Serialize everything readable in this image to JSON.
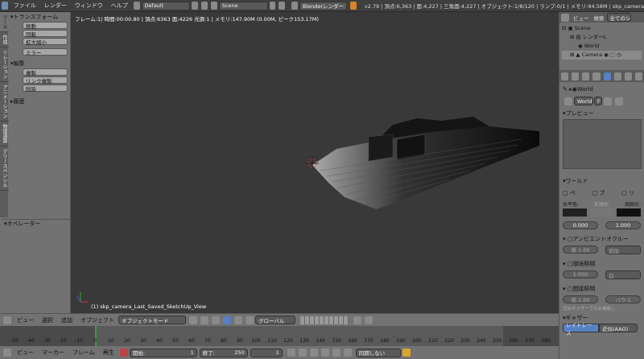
{
  "menu": {
    "file": "ファイル",
    "render": "レンダー",
    "window": "ウィンドウ",
    "help": "ヘルプ"
  },
  "screen_layout": "Default",
  "scene_name": "Scene",
  "engine": "Blenderレンダー",
  "stats": "v2.79 | 頂点:6,363 | 面:4,227 | 三角面:4,227 | オブジェクト:1/8/120 | ランプ:0/1 | メモリ:94.58M | skp_camera",
  "tool_panel": {
    "transform_title": "トランスフォーム",
    "move": "移動",
    "rotate": "回転",
    "scale": "拡大縮小",
    "mirror": "ミラー",
    "edit_title": "編集",
    "duplicate": "複製",
    "link_duplicate": "リンク複製",
    "delete": "削除",
    "history_title": "履歴",
    "operator_title": "オペレーター"
  },
  "tabs": [
    "ツール",
    "作成",
    "リレーション",
    "アニメーション",
    "物理演算",
    "グリースペンシル"
  ],
  "viewport": {
    "header": "フレーム:1| 時間:00:00.80 | 頂点:6363 面:4226 光源:1 | メモリ:147.90M (0.00M, ピーク153.17M)",
    "footer": "(1) skp_camera_Last_Saved_SketchUp_View"
  },
  "view3d_header": {
    "view": "ビュー",
    "select": "選択",
    "add": "追加",
    "object": "オブジェクト",
    "mode": "オブジェクトモード",
    "orientation": "グローバル"
  },
  "timeline": {
    "ticks": [
      "-50",
      "-40",
      "-30",
      "-20",
      "-10",
      "0",
      "10",
      "20",
      "30",
      "40",
      "50",
      "60",
      "70",
      "80",
      "90",
      "100",
      "110",
      "120",
      "130",
      "140",
      "150",
      "160",
      "170",
      "180",
      "190",
      "200",
      "210",
      "220",
      "230",
      "240",
      "250",
      "260",
      "270",
      "280"
    ],
    "current_frame": 1
  },
  "timeline_header": {
    "view": "ビュー",
    "marker": "マーカー",
    "frame": "フレーム",
    "playback": "再生",
    "start_label": "開始:",
    "start": "1",
    "end_label": "終了:",
    "end": "250",
    "current": "1",
    "sync": "同期しない"
  },
  "outliner": {
    "view": "ビュー",
    "search": "検索",
    "all_scenes": "全てのシ",
    "items": [
      "Scene",
      "レンダーL",
      "World",
      "Camera"
    ]
  },
  "properties": {
    "context": "World",
    "world_field": "World",
    "f_label": "F",
    "preview_title": "プレビュー",
    "world_panel": "ワールド",
    "paper_sky": "ペ",
    "blend_sky": "ブ",
    "real_sky": "リ",
    "horizon": "水平色:",
    "zenith": "天頂色:",
    "ambient": "周囲光:",
    "horizon_value": "0.000",
    "ambient_value": "1.000",
    "ao": "アンビエントオクルー",
    "ao_factor": "係 1.00",
    "ao_mode": "追加",
    "env_light": "環境照明",
    "env_value": "1.000",
    "env_color": "白",
    "indirect": "間接照明",
    "indirect_factor": "係 1.00",
    "bounces": "バウ 1",
    "indirect_note": "近似ギャザーでのみ機能し",
    "gather": "ギャザー",
    "raytrace": "レイトレース",
    "approx": "近似(AAO)"
  },
  "colors": {
    "viewport_bg": "#393939",
    "panel_bg": "#727272",
    "accent_green": "#3b9c3b",
    "selection_blue": "#5680c2"
  }
}
